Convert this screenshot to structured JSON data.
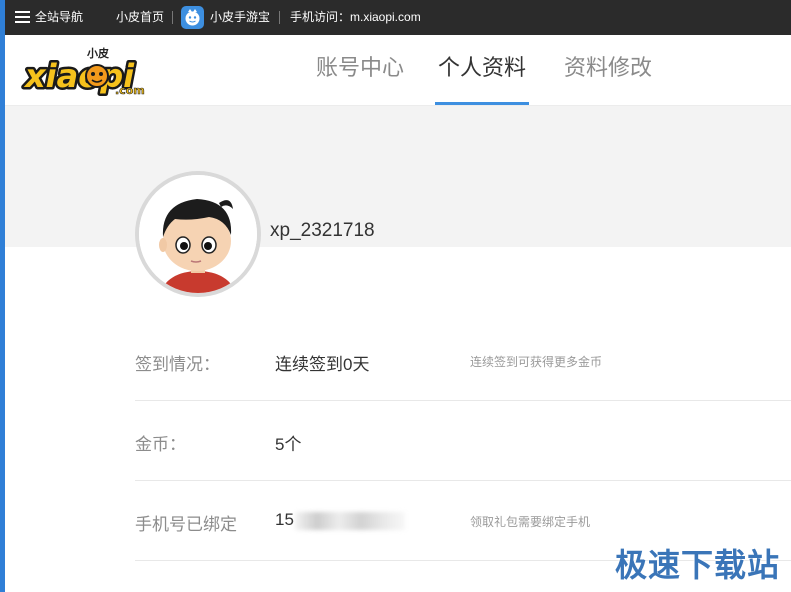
{
  "topbar": {
    "nav_all_label": "全站导航",
    "home_label": "小皮首页",
    "app_label": "小皮手游宝",
    "mobile_label": "手机访问：m.xiaopi.com",
    "icons": [
      "menu-icon",
      "phone-app-icon"
    ]
  },
  "logo": {
    "text_main": "xiaopi",
    "text_small": "小皮",
    "text_domain": ".com"
  },
  "nav": {
    "tabs": [
      {
        "label": "账号中心",
        "active": false
      },
      {
        "label": "个人资料",
        "active": true
      },
      {
        "label": "资料修改",
        "active": false
      }
    ]
  },
  "profile": {
    "username": "xp_2321718"
  },
  "info": {
    "checkin": {
      "label": "签到情况：",
      "value": "连续签到0天",
      "hint": "连续签到可获得更多金币"
    },
    "coins": {
      "label": "金币：",
      "value": "5个"
    },
    "phone": {
      "label": "手机号已绑定",
      "value": "15",
      "hint": "领取礼包需要绑定手机"
    }
  },
  "colors": {
    "accent": "#3d8fe0",
    "topbar_bg": "#2b2b2b",
    "band_bg": "#f3f3f3"
  },
  "watermark": "极速下载站"
}
